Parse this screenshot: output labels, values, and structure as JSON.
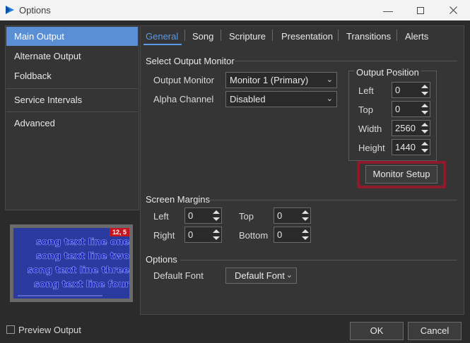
{
  "window": {
    "title": "Options",
    "accent": "#5a9ae8"
  },
  "nav": {
    "items": [
      {
        "label": "Main Output",
        "active": true
      },
      {
        "label": "Alternate Output"
      },
      {
        "label": "Foldback"
      },
      {
        "label": "Service Intervals"
      },
      {
        "label": "Advanced"
      }
    ]
  },
  "preview": {
    "lines": [
      "song text line one",
      "song text line two",
      "song text line three",
      "song text line four"
    ],
    "badge": "12, 5",
    "checkbox_label": "Preview Output",
    "checked": false
  },
  "tabs": [
    {
      "label": "General",
      "active": true
    },
    {
      "label": "Song"
    },
    {
      "label": "Scripture"
    },
    {
      "label": "Presentation"
    },
    {
      "label": "Transitions"
    },
    {
      "label": "Alerts"
    }
  ],
  "output_monitor": {
    "section": "Select Output Monitor",
    "monitor_label": "Output Monitor",
    "monitor_value": "Monitor 1 (Primary)",
    "alpha_label": "Alpha Channel",
    "alpha_value": "Disabled"
  },
  "output_position": {
    "title": "Output Position",
    "left_label": "Left",
    "left_value": "0",
    "top_label": "Top",
    "top_value": "0",
    "width_label": "Width",
    "width_value": "2560",
    "height_label": "Height",
    "height_value": "1440",
    "monitor_setup": "Monitor Setup"
  },
  "screen_margins": {
    "section": "Screen Margins",
    "left_label": "Left",
    "left_value": "0",
    "top_label": "Top",
    "top_value": "0",
    "right_label": "Right",
    "right_value": "0",
    "bottom_label": "Bottom",
    "bottom_value": "0"
  },
  "options": {
    "section": "Options",
    "font_label": "Default Font",
    "font_value": "Default Font"
  },
  "footer": {
    "ok": "OK",
    "cancel": "Cancel"
  }
}
